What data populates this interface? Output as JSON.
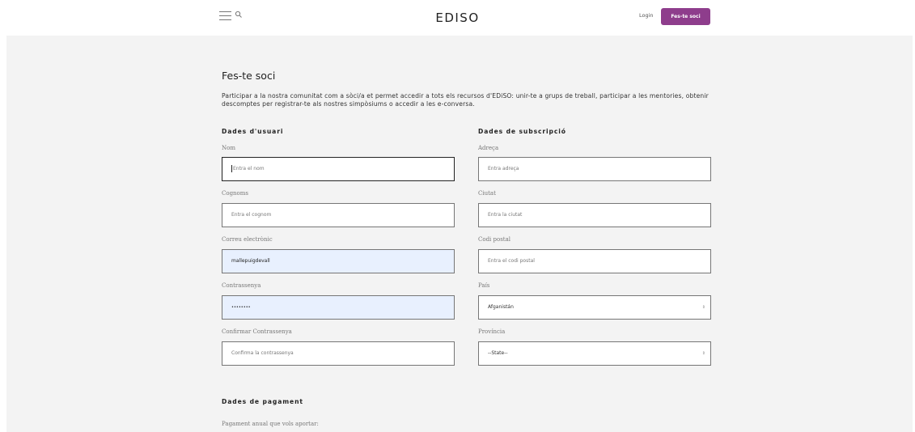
{
  "header": {
    "brand": "EDISO",
    "login_label": "Login",
    "cta_label": "Fes-te soci",
    "accent_color": "#8e3d8c",
    "menu_icon": "hamburger-icon",
    "search_icon": "search-icon"
  },
  "main": {
    "title": "Fes-te soci",
    "intro": "Participar a la nostra comunitat com a sòci/a et permet accedir a tots els recursos d'EDiSO: unir-te a grups de treball, participar a les mentories, obtenir descomptes per registrar-te als nostres simpòsiums o accedir a les e-conversa."
  },
  "user_section": {
    "heading": "Dades d'usuari",
    "fields": [
      {
        "label": "Nom",
        "placeholder": "Entra el nom",
        "value": ""
      },
      {
        "label": "Cognoms",
        "placeholder": "Entra el cognom",
        "value": ""
      },
      {
        "label": "Correu electrònic",
        "placeholder": "",
        "value": "mallepuigdevall"
      },
      {
        "label": "Contrassenya",
        "placeholder": "",
        "value": "••••••••"
      },
      {
        "label": "Confirmar Contrassenya",
        "placeholder": "Confirma la contrassenya",
        "value": ""
      }
    ]
  },
  "subscription_section": {
    "heading": "Dades de subscripció",
    "fields": [
      {
        "label": "Adreça",
        "placeholder": "Entra adreça",
        "value": ""
      },
      {
        "label": "Ciutat",
        "placeholder": "Entra la ciutat",
        "value": ""
      },
      {
        "label": "Codi postal",
        "placeholder": "Entra el codi postal",
        "value": ""
      },
      {
        "label": "País",
        "value": "Afganistán"
      },
      {
        "label": "Província",
        "value": "--State--"
      }
    ]
  },
  "payment_section": {
    "heading": "Dades de pagament",
    "label": "Pagament anual que vols aportar:"
  }
}
